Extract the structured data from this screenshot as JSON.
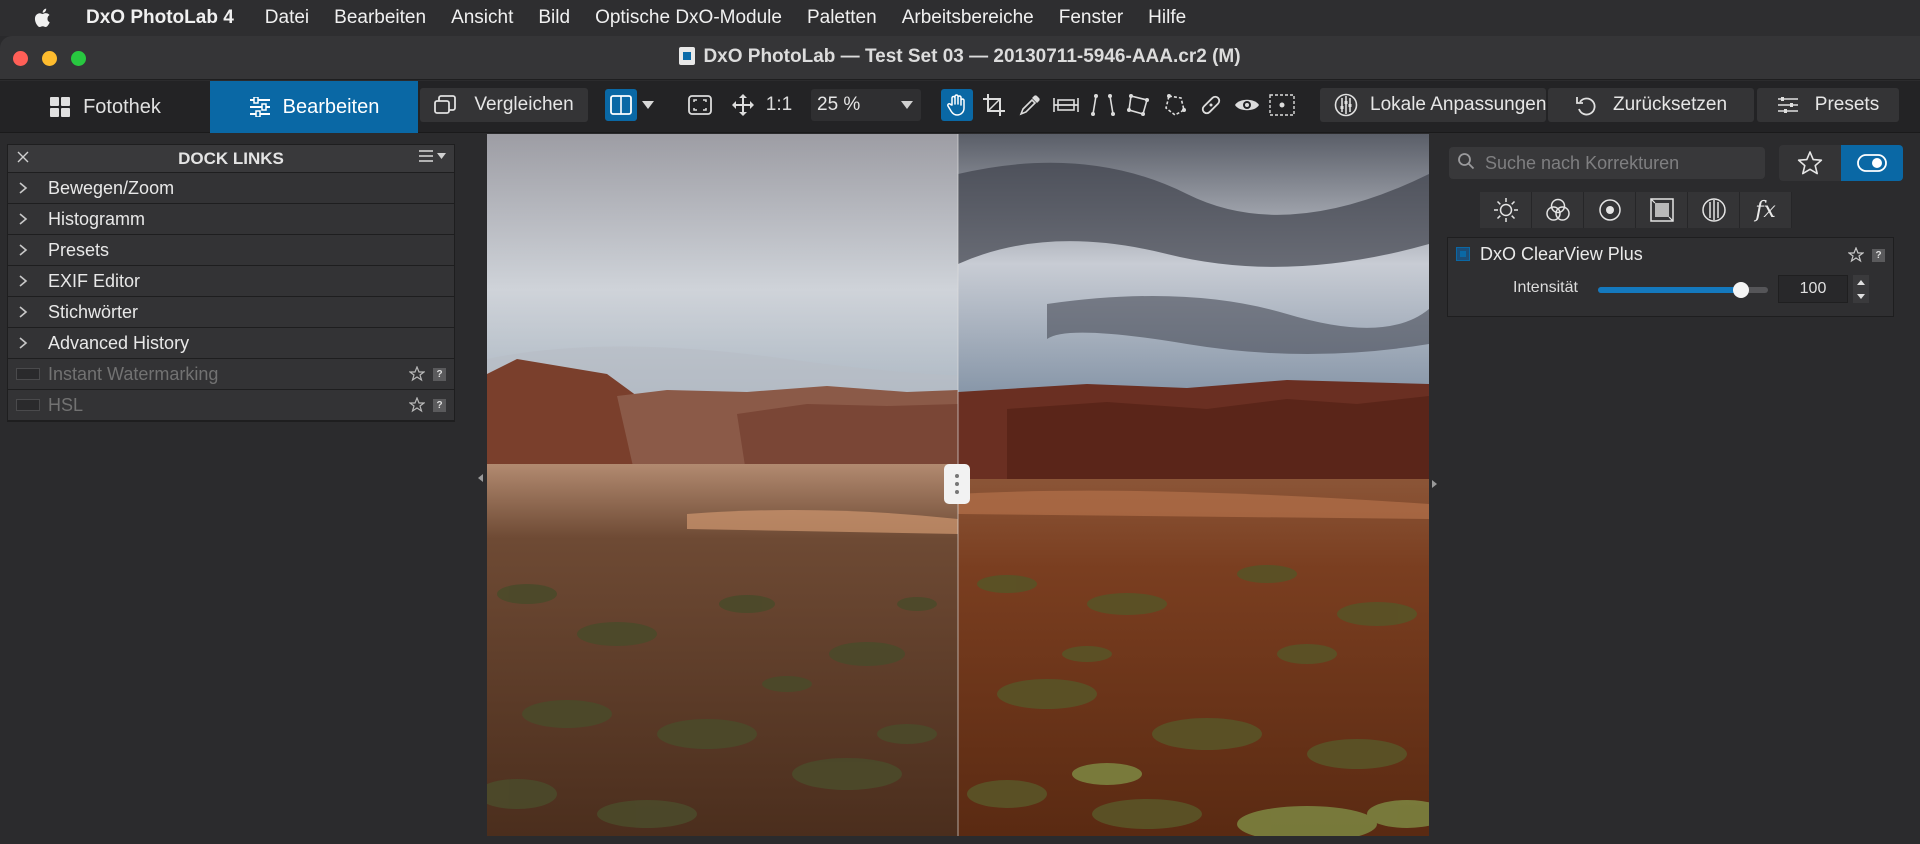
{
  "menubar": {
    "app_name": "DxO PhotoLab 4",
    "items": [
      "Datei",
      "Bearbeiten",
      "Ansicht",
      "Bild",
      "Optische DxO-Module",
      "Paletten",
      "Arbeitsbereiche",
      "Fenster",
      "Hilfe"
    ]
  },
  "window": {
    "title": "DxO PhotoLab — Test Set 03 — 20130711-5946-AAA.cr2 (M)"
  },
  "toolbar": {
    "tabs": [
      {
        "label": "Fotothek",
        "icon": "grid-icon",
        "active": false
      },
      {
        "label": "Bearbeiten",
        "icon": "sliders-icon",
        "active": true
      }
    ],
    "compare_label": "Vergleichen",
    "fit_label": "1:1",
    "zoom_value": "25 %",
    "local_adjust_label": "Lokale Anpassungen",
    "reset_label": "Zurücksetzen",
    "presets_label": "Presets",
    "tools": [
      "hand-icon",
      "crop-icon",
      "eyedropper-icon",
      "horizon-icon",
      "perspective-icon",
      "volume-deformation-icon",
      "miniature-icon",
      "repair-icon",
      "red-eye-icon",
      "watermark-icon"
    ],
    "accent_color": "#0a68a5"
  },
  "dock": {
    "title": "DOCK LINKS",
    "items": [
      {
        "label": "Bewegen/Zoom",
        "enabled": true
      },
      {
        "label": "Histogramm",
        "enabled": true
      },
      {
        "label": "Presets",
        "enabled": true
      },
      {
        "label": "EXIF Editor",
        "enabled": true
      },
      {
        "label": "Stichwörter",
        "enabled": true
      },
      {
        "label": "Advanced History",
        "enabled": true
      },
      {
        "label": "Instant Watermarking",
        "enabled": false
      },
      {
        "label": "HSL",
        "enabled": false
      }
    ]
  },
  "viewer": {
    "mode": "split-before-after",
    "split_fraction": 0.5
  },
  "right_panel": {
    "search_placeholder": "Suche nach Korrekturen",
    "categories": [
      "light-icon",
      "color-icon",
      "detail-icon",
      "geometry-icon",
      "local-icon",
      "fx"
    ],
    "palette": {
      "title": "DxO ClearView Plus",
      "enabled": true,
      "slider_label": "Intensität",
      "slider_value": "100",
      "slider_fraction": 0.84
    }
  }
}
